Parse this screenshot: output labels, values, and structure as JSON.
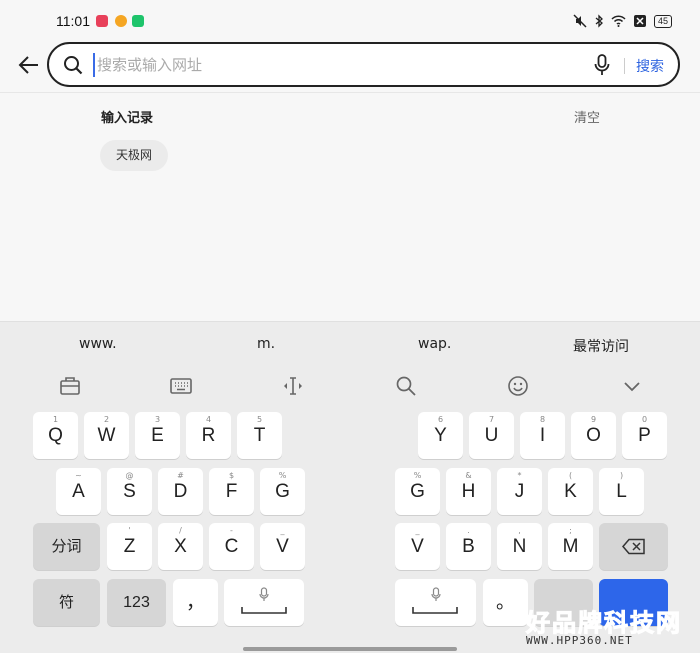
{
  "status_bar": {
    "time": "11:01",
    "battery": "45",
    "app_icon_colors": [
      "#e8405a",
      "#f5a623",
      "#1ec46b"
    ]
  },
  "search": {
    "placeholder": "搜索或输入网址",
    "value": "",
    "submit_label": "搜索",
    "accent_color": "#2e64e0"
  },
  "history": {
    "title": "输入记录",
    "clear_label": "清空",
    "items": [
      "天极网"
    ]
  },
  "suggestions": [
    "www.",
    "m.",
    "wap.",
    "最常访问"
  ],
  "keyboard": {
    "row1_left": [
      {
        "l": "Q",
        "s": "1"
      },
      {
        "l": "W",
        "s": "2"
      },
      {
        "l": "E",
        "s": "3"
      },
      {
        "l": "R",
        "s": "4"
      },
      {
        "l": "T",
        "s": "5"
      }
    ],
    "row1_right": [
      {
        "l": "Y",
        "s": "6"
      },
      {
        "l": "U",
        "s": "7"
      },
      {
        "l": "I",
        "s": "8"
      },
      {
        "l": "O",
        "s": "9"
      },
      {
        "l": "P",
        "s": "0"
      }
    ],
    "row2_left": [
      {
        "l": "A",
        "s": "~"
      },
      {
        "l": "S",
        "s": "@"
      },
      {
        "l": "D",
        "s": "#"
      },
      {
        "l": "F",
        "s": "$"
      },
      {
        "l": "G",
        "s": "%"
      }
    ],
    "row2_right": [
      {
        "l": "G",
        "s": "%"
      },
      {
        "l": "H",
        "s": "&"
      },
      {
        "l": "J",
        "s": "*"
      },
      {
        "l": "K",
        "s": "("
      },
      {
        "l": "L",
        "s": ")"
      }
    ],
    "row3_left": [
      {
        "l": "Z",
        "s": "'"
      },
      {
        "l": "X",
        "s": "/"
      },
      {
        "l": "C",
        "s": "-"
      },
      {
        "l": "V",
        "s": "_"
      }
    ],
    "row3_right": [
      {
        "l": "V",
        "s": "_"
      },
      {
        "l": "B",
        "s": "."
      },
      {
        "l": "N",
        "s": ","
      },
      {
        "l": "M",
        "s": ";"
      }
    ],
    "segment_label": "分词",
    "symbol_label": "符",
    "numbers_label": "123",
    "comma": "，",
    "period": "。",
    "enter_color": "#2d66ea"
  },
  "watermark": {
    "title": "好品牌科技网",
    "url": "WWW.HPP360.NET"
  }
}
